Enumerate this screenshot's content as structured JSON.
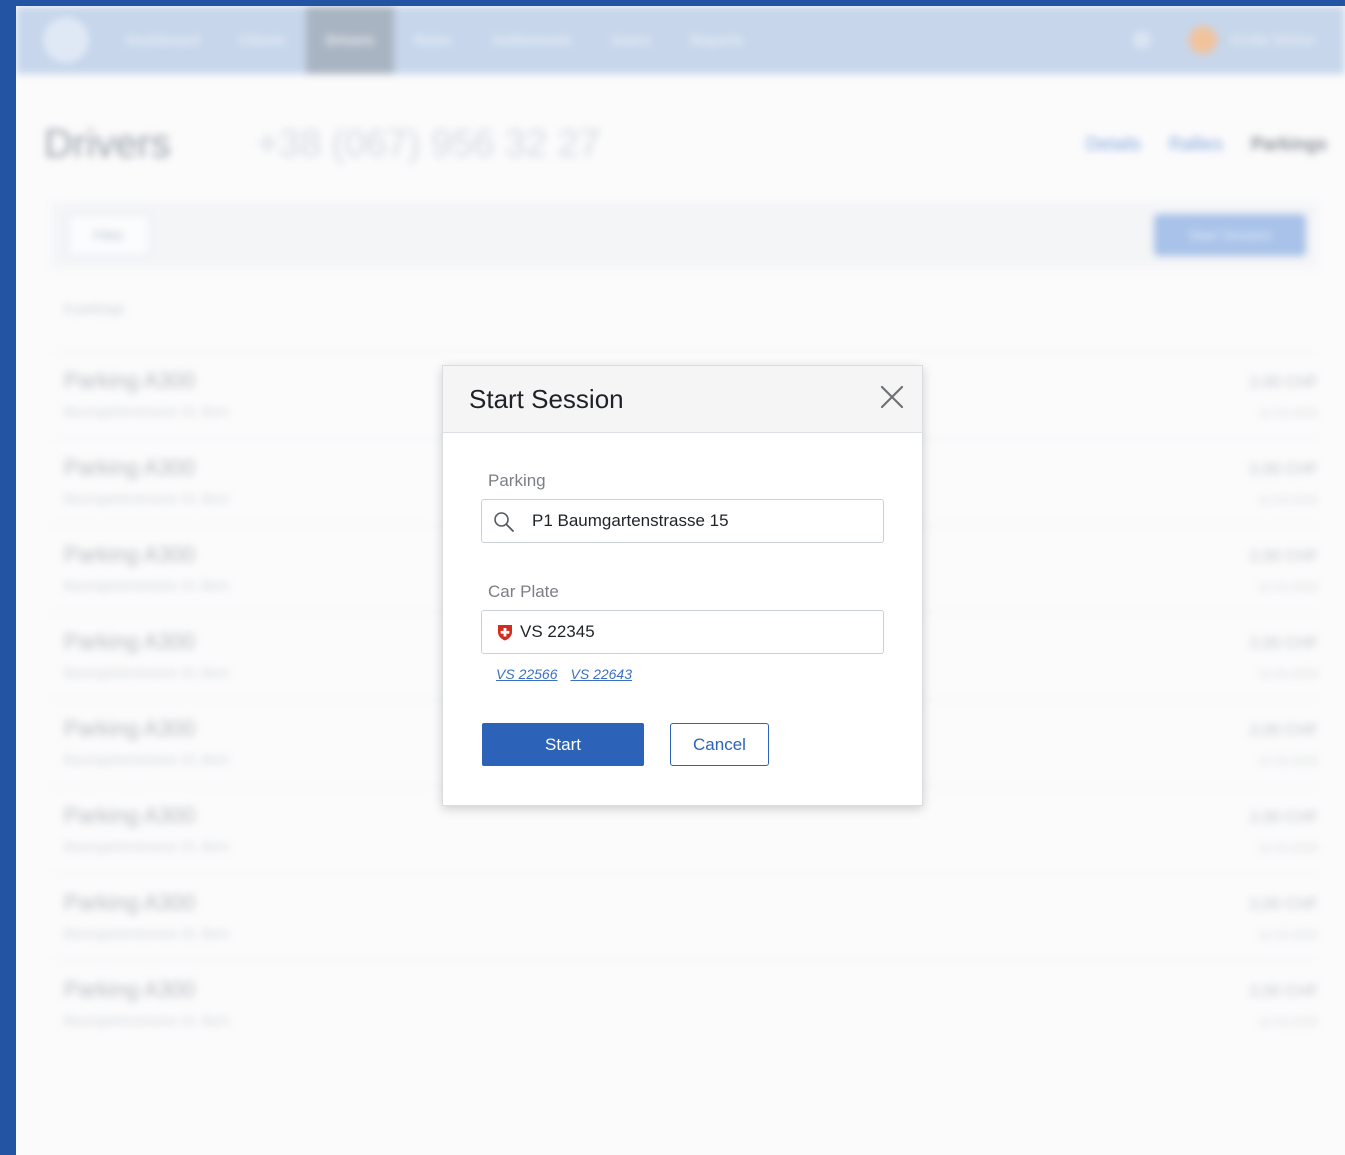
{
  "navbar": {
    "items": [
      {
        "label": "Dashboard"
      },
      {
        "label": "Clients"
      },
      {
        "label": "Drivers"
      },
      {
        "label": "Rates"
      },
      {
        "label": "Settlements"
      },
      {
        "label": "Users"
      },
      {
        "label": "Reports"
      }
    ],
    "active_index": 2,
    "username": "Emile Weber"
  },
  "page": {
    "title": "Drivers",
    "phone": "+38 (067) 956 32 27",
    "links": [
      {
        "label": "Details"
      },
      {
        "label": "Rallies"
      },
      {
        "label": "Parkings"
      }
    ]
  },
  "toolbar": {
    "filter_label": "Filter",
    "new_button_label": "Start Session"
  },
  "list": {
    "count": "8 parkings",
    "rows": [
      {
        "title": "Parking A300",
        "subtitle": "Baumgartenstrasse 15, Bern",
        "value": "2,00 CHF",
        "meta": "12.03.2020"
      },
      {
        "title": "Parking A300",
        "subtitle": "Baumgartenstrasse 15, Bern",
        "value": "2,00 CHF",
        "meta": "12.03.2020"
      },
      {
        "title": "Parking A300",
        "subtitle": "Baumgartenstrasse 15, Bern",
        "value": "2,00 CHF",
        "meta": "12.03.2020"
      },
      {
        "title": "Parking A300",
        "subtitle": "Baumgartenstrasse 15, Bern",
        "value": "2,00 CHF",
        "meta": "12.03.2020"
      },
      {
        "title": "Parking A300",
        "subtitle": "Baumgartenstrasse 15, Bern",
        "value": "2,00 CHF",
        "meta": "12.03.2020"
      },
      {
        "title": "Parking A300",
        "subtitle": "Baumgartenstrasse 15, Bern",
        "value": "2,00 CHF",
        "meta": "12.03.2020"
      },
      {
        "title": "Parking A300",
        "subtitle": "Baumgartenstrasse 15, Bern",
        "value": "2,00 CHF",
        "meta": "12.03.2020"
      },
      {
        "title": "Parking A300",
        "subtitle": "Baumgartenstrasse 15, Bern",
        "value": "2,00 CHF",
        "meta": "12.03.2020"
      }
    ]
  },
  "modal": {
    "title": "Start Session",
    "close_icon": "close-icon",
    "parking": {
      "label": "Parking",
      "value": "P1 Baumgartenstrasse 15",
      "icon": "search-icon"
    },
    "car_plate": {
      "label": "Car Plate",
      "value": "VS 22345",
      "flag_icon": "swiss-flag-icon",
      "suggestions": [
        "VS 22566",
        "VS 22643"
      ]
    },
    "start_label": "Start",
    "cancel_label": "Cancel"
  },
  "colors": {
    "frame": "#2353a3",
    "primary": "#2c63b8",
    "link": "#3b6fc0",
    "swiss_red": "#d52b1e"
  }
}
